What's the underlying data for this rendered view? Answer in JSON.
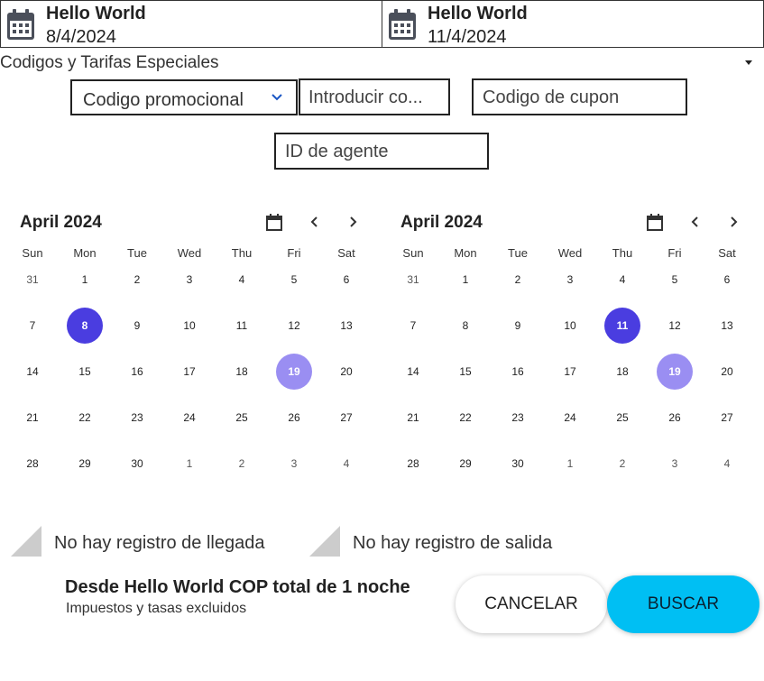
{
  "dates": {
    "checkin": {
      "label": "Hello World",
      "value": "8/4/2024",
      "icon": "calendar-icon"
    },
    "checkout": {
      "label": "Hello World",
      "value": "11/4/2024",
      "icon": "calendar-icon"
    }
  },
  "codes": {
    "toggle_label": "Codigos y Tarifas Especiales",
    "promo_type": "Codigo promocional",
    "promo_input_placeholder": "Introducir co...",
    "coupon_placeholder": "Codigo de cupon",
    "agent_placeholder": "ID de agente"
  },
  "calendars": [
    {
      "month": "April 2024",
      "weekdays": [
        "Sun",
        "Mon",
        "Tue",
        "Wed",
        "Thu",
        "Fri",
        "Sat"
      ],
      "weeks": [
        [
          "31",
          "1",
          "2",
          "3",
          "4",
          "5",
          "6"
        ],
        [
          "7",
          "8",
          "9",
          "10",
          "11",
          "12",
          "13"
        ],
        [
          "14",
          "15",
          "16",
          "17",
          "18",
          "19",
          "20"
        ],
        [
          "21",
          "22",
          "23",
          "24",
          "25",
          "26",
          "27"
        ],
        [
          "28",
          "29",
          "30",
          "1",
          "2",
          "3",
          "4"
        ]
      ],
      "selected": "8",
      "today": "19"
    },
    {
      "month": "April 2024",
      "weekdays": [
        "Sun",
        "Mon",
        "Tue",
        "Wed",
        "Thu",
        "Fri",
        "Sat"
      ],
      "weeks": [
        [
          "31",
          "1",
          "2",
          "3",
          "4",
          "5",
          "6"
        ],
        [
          "7",
          "8",
          "9",
          "10",
          "11",
          "12",
          "13"
        ],
        [
          "14",
          "15",
          "16",
          "17",
          "18",
          "19",
          "20"
        ],
        [
          "21",
          "22",
          "23",
          "24",
          "25",
          "26",
          "27"
        ],
        [
          "28",
          "29",
          "30",
          "1",
          "2",
          "3",
          "4"
        ]
      ],
      "selected": "11",
      "today": "19"
    }
  ],
  "records": {
    "checkin": "No hay registro de llegada",
    "checkout": "No hay registro de salida"
  },
  "summary": {
    "title": "Desde Hello World COP total de 1 noche",
    "subtitle": "Impuestos y tasas excluidos"
  },
  "actions": {
    "cancel": "CANCELAR",
    "search": "BUSCAR"
  },
  "colors": {
    "selected_day": "#4a3de0",
    "today_day": "#9a8ef2",
    "search_button": "#00bff3"
  }
}
